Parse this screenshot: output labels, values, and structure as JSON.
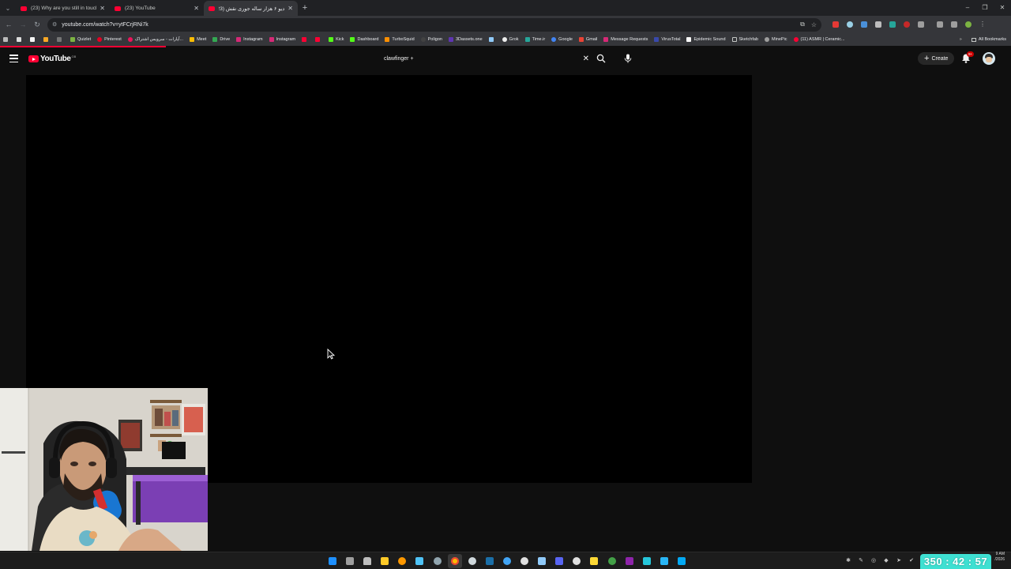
{
  "browser": {
    "tabs": [
      {
        "title": "(23) Why are you still in touch",
        "active": false
      },
      {
        "title": "(23) YouTube",
        "active": false
      },
      {
        "title": "دیو ۶ هزار ساله جوری نقش (23)",
        "active": true
      }
    ],
    "new_tab_label": "+",
    "url": "youtube.com/watch?v=ytFCrjRNi7k",
    "bookmarks": [
      "Quizlet",
      "Pinterest",
      "آپارات - سرویس اشتراک...",
      "Meet",
      "Drive",
      "Instagram",
      "Instagram",
      "",
      "",
      "Kick",
      "Dashboard",
      "TurboSquid",
      "Poligon",
      "3Dassets.one",
      "",
      "Grok",
      "Time.ir",
      "Google",
      "Gmail",
      "Message Requests",
      "VirusTotal",
      "Epidemic Sound",
      "Sketchfab",
      "MinePic",
      "(11) ASMR | Ceramic..."
    ],
    "all_bookmarks_label": "All Bookmarks",
    "accent_color": "#ff0033"
  },
  "youtube": {
    "logo_text": "YouTube",
    "country_code": "GB",
    "search_value": "clawfinger +",
    "create_label": "Create",
    "notification_count": "9+"
  },
  "taskbar": {
    "clock_time": "9 AM",
    "clock_date": "/2026"
  },
  "stream_timer": "350 : 42 : 57"
}
